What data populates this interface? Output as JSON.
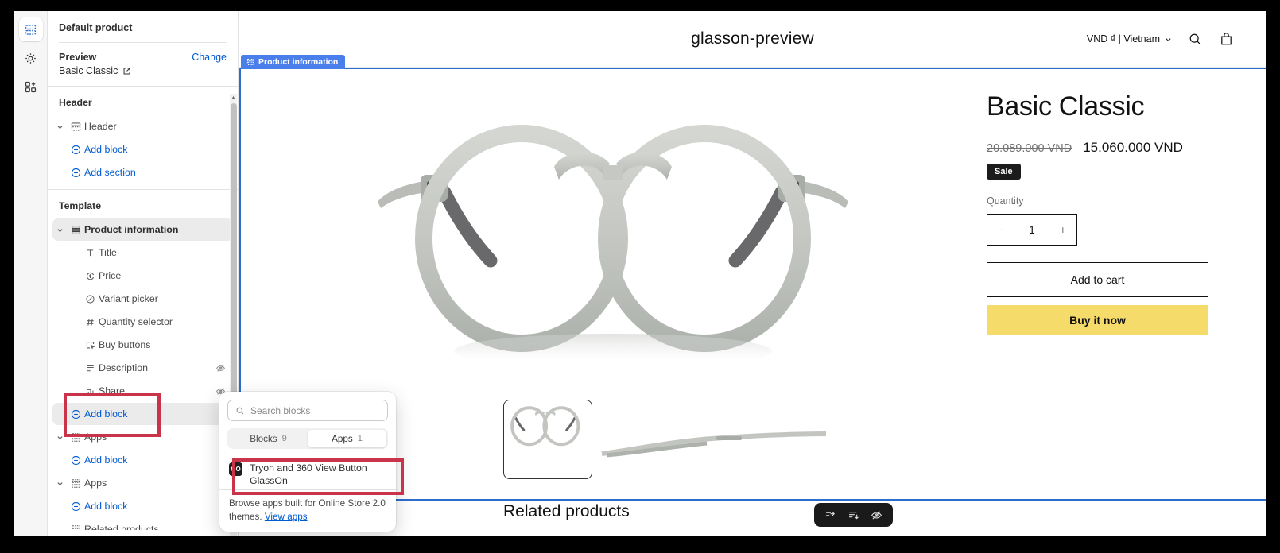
{
  "rail": {
    "items": [
      {
        "name": "sections-icon",
        "label": "Sections"
      },
      {
        "name": "settings-icon",
        "label": "Theme settings"
      },
      {
        "name": "apps-icon",
        "label": "Apps"
      }
    ]
  },
  "sidebar": {
    "default_product": "Default product",
    "preview_label": "Preview",
    "change_link": "Change",
    "preview_value": "Basic Classic",
    "header_group": "Header",
    "template_group": "Template",
    "rows": [
      {
        "label": "Header",
        "type": "section",
        "indent": 0,
        "chevron": true,
        "icon": "section-icon",
        "selected": false,
        "hidden": false
      },
      {
        "label": "Add block",
        "type": "add",
        "indent": 1,
        "chevron": false,
        "icon": "plus-icon",
        "selected": false,
        "hidden": false
      },
      {
        "label": "Add section",
        "type": "add",
        "indent": 0,
        "chevron": false,
        "icon": "plus-icon",
        "selected": false,
        "hidden": false
      },
      {
        "label": "Product information",
        "type": "section",
        "indent": 0,
        "chevron": true,
        "icon": "section-icon",
        "selected": true,
        "hidden": false
      },
      {
        "label": "Title",
        "type": "block",
        "indent": 1,
        "chevron": false,
        "icon": "text-icon",
        "selected": false,
        "hidden": false
      },
      {
        "label": "Price",
        "type": "block",
        "indent": 1,
        "chevron": false,
        "icon": "price-icon",
        "selected": false,
        "hidden": false
      },
      {
        "label": "Variant picker",
        "type": "block",
        "indent": 1,
        "chevron": false,
        "icon": "variant-icon",
        "selected": false,
        "hidden": false
      },
      {
        "label": "Quantity selector",
        "type": "block",
        "indent": 1,
        "chevron": false,
        "icon": "hash-icon",
        "selected": false,
        "hidden": false
      },
      {
        "label": "Buy buttons",
        "type": "block",
        "indent": 1,
        "chevron": false,
        "icon": "cursor-icon",
        "selected": false,
        "hidden": false
      },
      {
        "label": "Description",
        "type": "block",
        "indent": 1,
        "chevron": false,
        "icon": "lines-icon",
        "selected": false,
        "hidden": true
      },
      {
        "label": "Share",
        "type": "block",
        "indent": 1,
        "chevron": false,
        "icon": "share-icon",
        "selected": false,
        "hidden": true
      },
      {
        "label": "Add block",
        "type": "add",
        "indent": 1,
        "chevron": false,
        "icon": "plus-icon",
        "selected": true,
        "hidden": false
      },
      {
        "label": "Apps",
        "type": "section",
        "indent": 0,
        "chevron": true,
        "icon": "section-icon",
        "selected": false,
        "hidden": false
      },
      {
        "label": "Add block",
        "type": "add",
        "indent": 1,
        "chevron": false,
        "icon": "plus-icon",
        "selected": false,
        "hidden": false
      },
      {
        "label": "Apps",
        "type": "section",
        "indent": 0,
        "chevron": true,
        "icon": "section-icon",
        "selected": false,
        "hidden": false
      },
      {
        "label": "Add block",
        "type": "add",
        "indent": 1,
        "chevron": false,
        "icon": "plus-icon",
        "selected": false,
        "hidden": false
      },
      {
        "label": "Related products",
        "type": "section",
        "indent": 0,
        "chevron": false,
        "icon": "section-icon",
        "selected": false,
        "hidden": false
      }
    ]
  },
  "popover": {
    "search_placeholder": "Search blocks",
    "tabs": [
      {
        "label": "Blocks",
        "count": "9",
        "active": false
      },
      {
        "label": "Apps",
        "count": "1",
        "active": true
      }
    ],
    "app_item": {
      "logo_text": "GO",
      "title": "Tryon and 360 View Button",
      "subtitle": "GlassOn"
    },
    "footer_text": "Browse apps built for Online Store 2.0 themes.",
    "footer_link": "View apps"
  },
  "preview": {
    "section_tab_label": "Product information",
    "shop_name": "glasson-preview",
    "locale": "VND ₫ | Vietnam",
    "product": {
      "title": "Basic Classic",
      "old_price": "20.089.000 VND",
      "new_price": "15.060.000 VND",
      "sale_badge": "Sale",
      "quantity_label": "Quantity",
      "quantity_value": "1",
      "decrease": "−",
      "increase": "+",
      "add_to_cart": "Add to cart",
      "buy_it_now": "Buy it now"
    },
    "related_title": "Related products",
    "toolbar_icons": [
      "reorder-icon",
      "align-icon",
      "hide-icon"
    ]
  },
  "colors": {
    "accent_blue": "#005bd3",
    "section_outline": "#2c6ecb",
    "section_tab": "#4a7eeb",
    "annotation_red": "#c9344a",
    "buy_now_yellow": "#f5dc6a",
    "sale_badge_bg": "#1c1c1c"
  }
}
